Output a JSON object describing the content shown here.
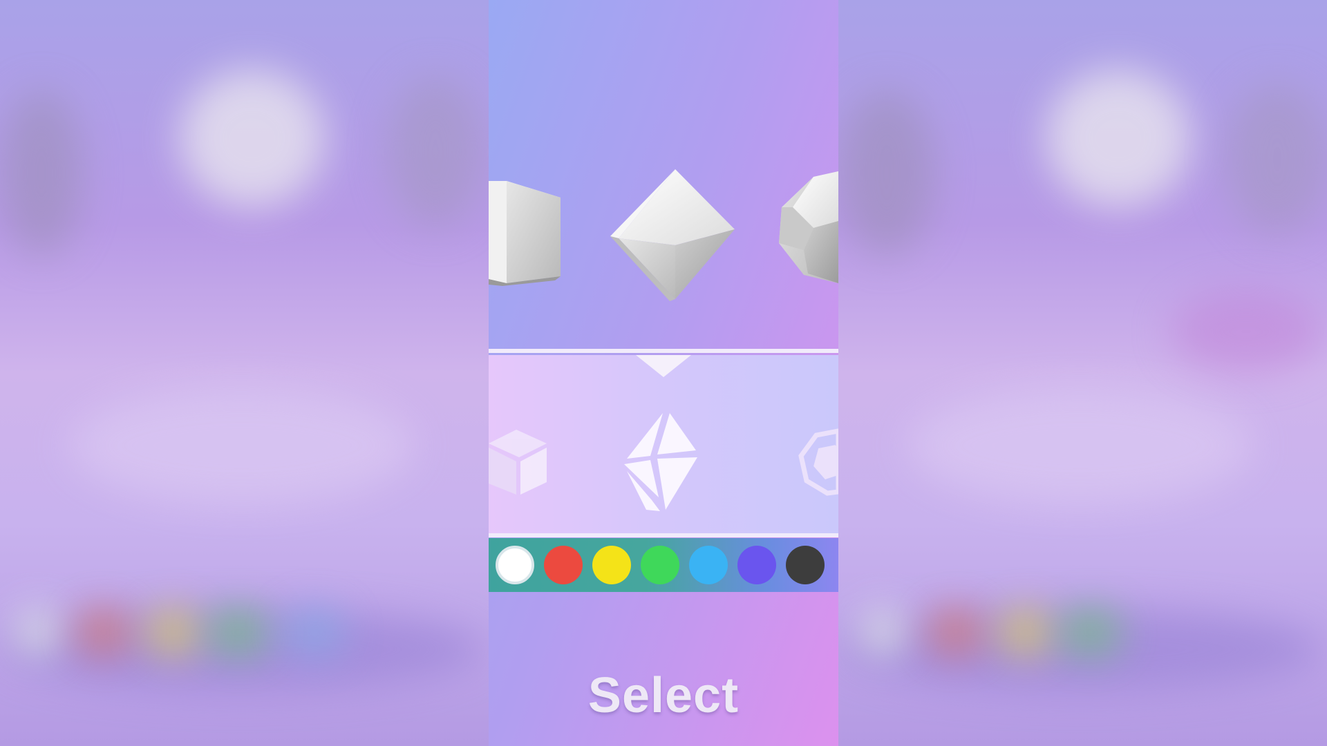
{
  "selector": {
    "shapes_3d": [
      {
        "name": "cube",
        "icon": "cube-icon"
      },
      {
        "name": "octahedron",
        "icon": "octahedron-icon",
        "selected": true
      },
      {
        "name": "dodecahedron",
        "icon": "dodecahedron-icon"
      }
    ],
    "shape_icons": [
      "cube-icon",
      "octahedron-icon",
      "dodecahedron-icon"
    ],
    "selected_shape": "octahedron",
    "pointer_icon": "triangle-down-icon"
  },
  "palette": {
    "colors": [
      "#ffffff",
      "#ec4a3f",
      "#f4e318",
      "#3fd85a",
      "#3ab3f4",
      "#6a55ee",
      "#3d3d3d"
    ],
    "selected_index": 0
  },
  "action": {
    "select_label": "Select"
  }
}
